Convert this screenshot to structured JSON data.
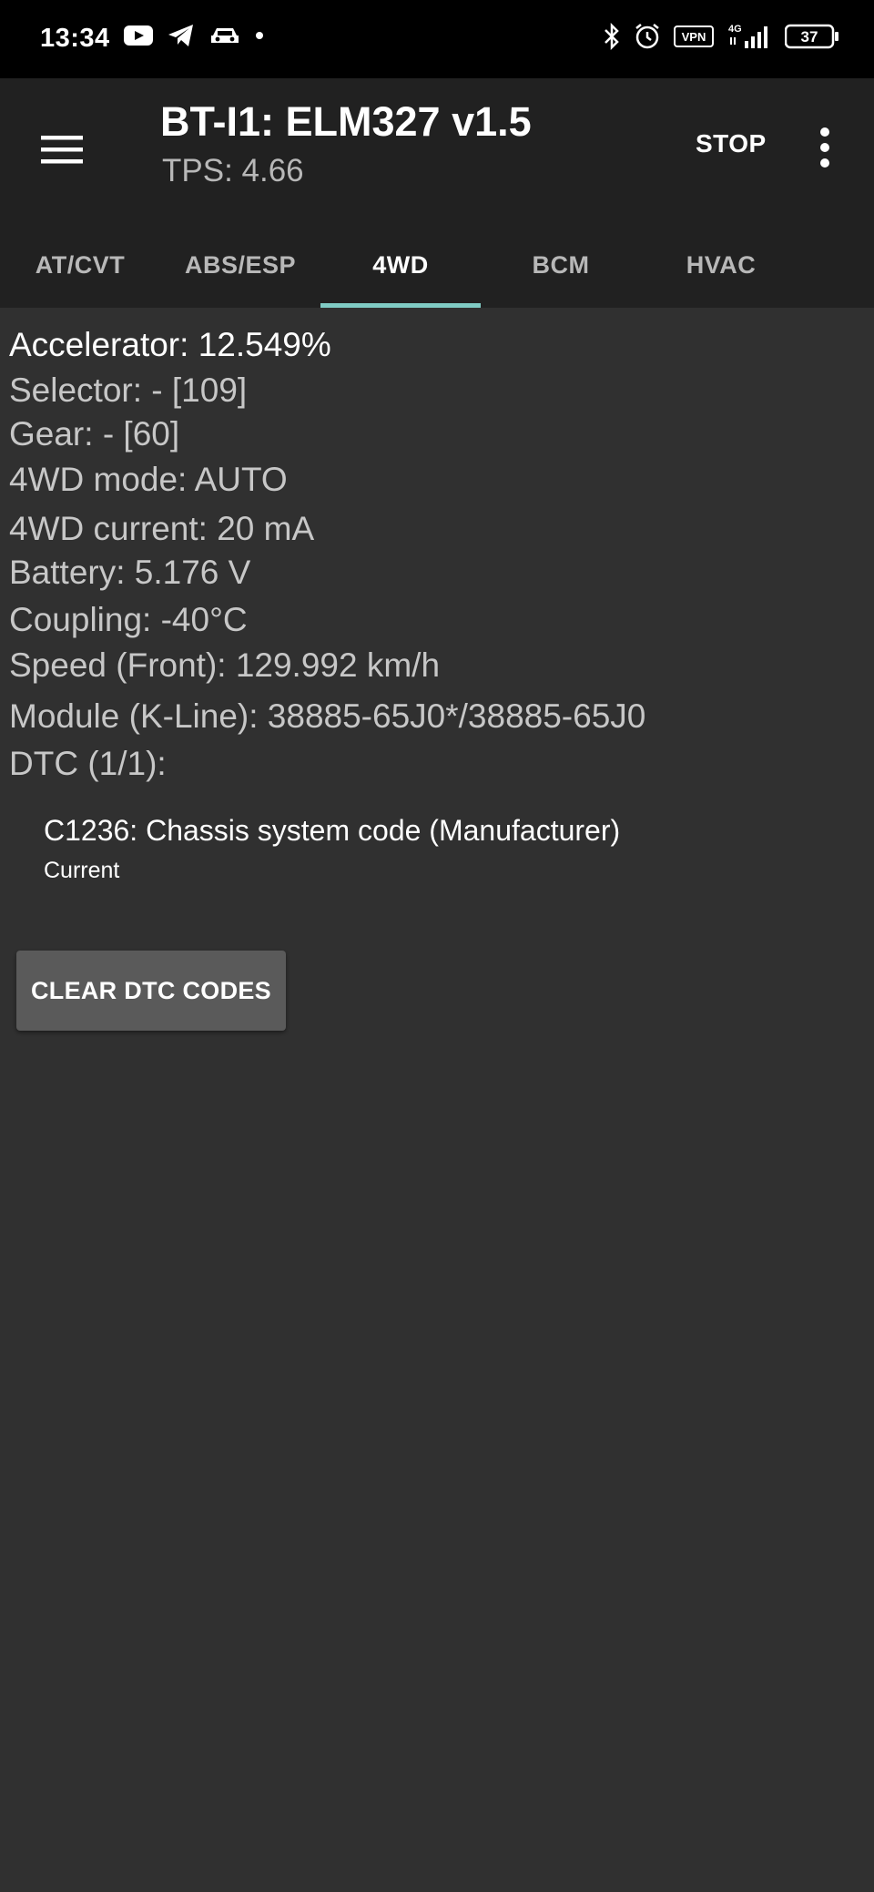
{
  "status_bar": {
    "time": "13:34",
    "left_icons": [
      "youtube-icon",
      "telegram-icon",
      "car-icon",
      "dot-icon"
    ],
    "right_icons": [
      "bluetooth-icon",
      "alarm-icon",
      "vpn-icon",
      "signal-4g-icon",
      "battery-icon"
    ],
    "vpn_label": "VPN",
    "network_label": "4G",
    "battery": "37"
  },
  "appbar": {
    "title": "BT-I1: ELM327 v1.5",
    "subtitle": "TPS: 4.66",
    "stop_label": "STOP",
    "menu_icon": "hamburger-menu-icon",
    "overflow_icon": "more-vert-icon"
  },
  "tabs": [
    {
      "label": "AT/CVT",
      "active": false
    },
    {
      "label": "ABS/ESP",
      "active": false
    },
    {
      "label": "4WD",
      "active": true
    },
    {
      "label": "BCM",
      "active": false
    },
    {
      "label": "HVAC",
      "active": false
    }
  ],
  "params": [
    "Accelerator: 12.549%",
    "Selector: - [109]",
    "Gear: - [60]",
    "4WD mode: AUTO",
    "4WD current: 20 mA",
    "Battery: 5.176 V",
    "Coupling: -40°C",
    "Speed (Front): 129.992 km/h",
    "Module (K-Line): 38885-65J0*/38885-65J0",
    "DTC (1/1):"
  ],
  "dtc": {
    "code": "C1236: Chassis system code (Manufacturer)",
    "status": "Current"
  },
  "clear_button_label": "CLEAR DTC CODES",
  "colors": {
    "background": "#303030",
    "appbar": "#212121",
    "status_bar": "#000000",
    "tab_indicator": "#80cbc4",
    "button": "#5a5a5a"
  }
}
